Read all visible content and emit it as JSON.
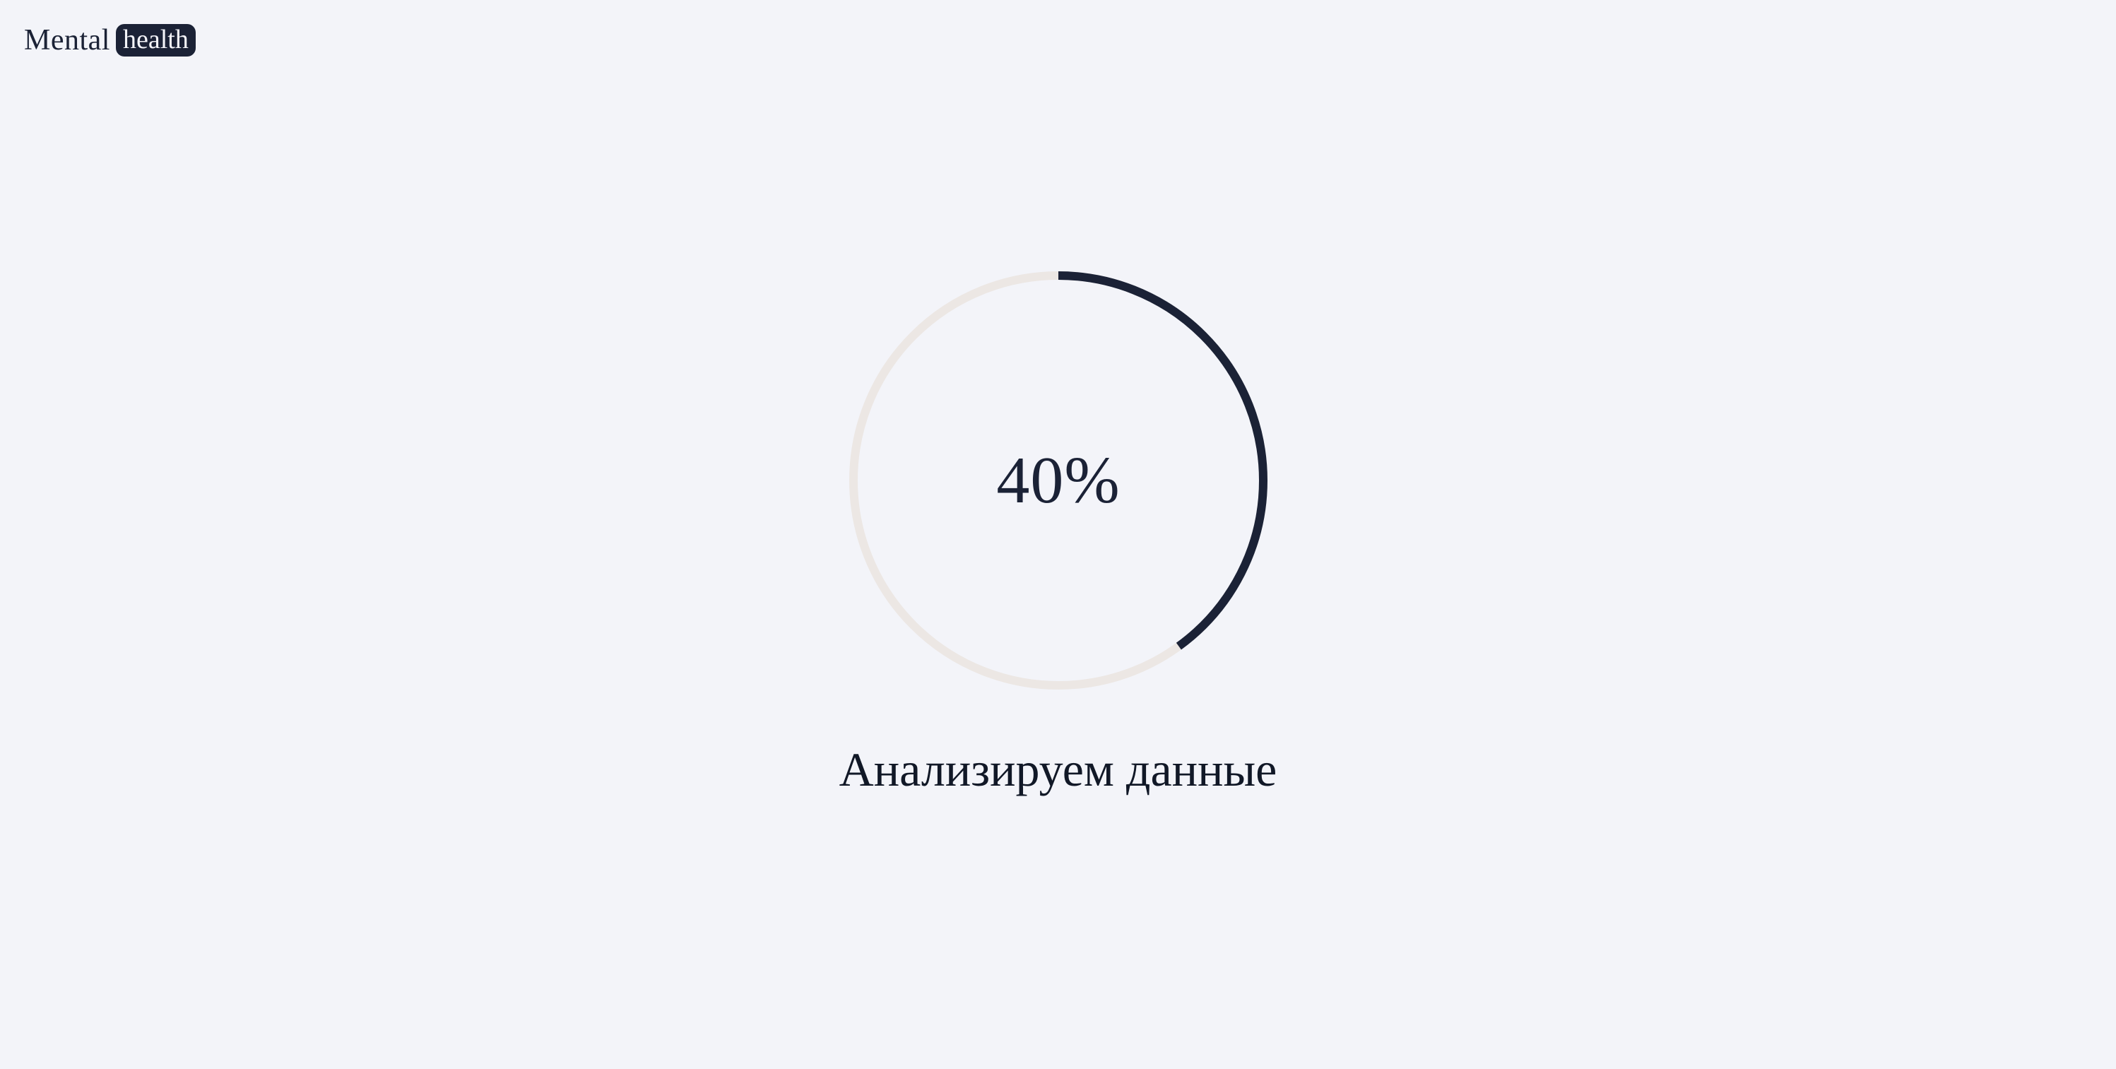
{
  "brand": {
    "word": "Mental",
    "badge": "health"
  },
  "progress": {
    "value_text": "40%",
    "fraction": 0.4,
    "track_color": "#ece7e4",
    "fill_color": "#1b2236"
  },
  "status": {
    "text": "Анализируем данные"
  },
  "colors": {
    "background": "#f3f4f9",
    "ink": "#1b2236"
  }
}
